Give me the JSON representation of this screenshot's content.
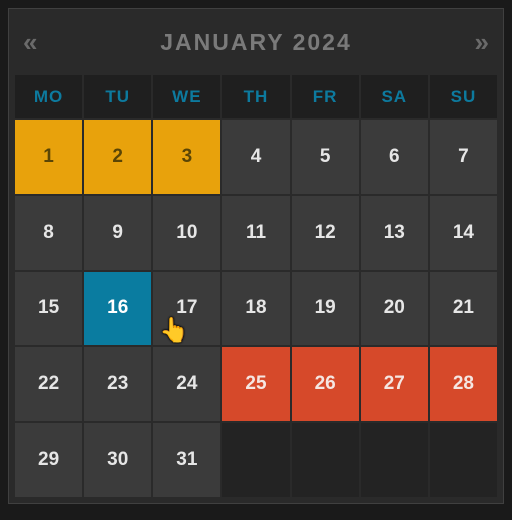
{
  "header": {
    "title": "JANUARY 2024",
    "prev_icon": "«",
    "next_icon": "»"
  },
  "dow": [
    "MO",
    "TU",
    "WE",
    "TH",
    "FR",
    "SA",
    "SU"
  ],
  "cells": [
    {
      "n": "1",
      "s": "yellow"
    },
    {
      "n": "2",
      "s": "yellow"
    },
    {
      "n": "3",
      "s": "yellow"
    },
    {
      "n": "4",
      "s": ""
    },
    {
      "n": "5",
      "s": ""
    },
    {
      "n": "6",
      "s": ""
    },
    {
      "n": "7",
      "s": ""
    },
    {
      "n": "8",
      "s": ""
    },
    {
      "n": "9",
      "s": ""
    },
    {
      "n": "10",
      "s": ""
    },
    {
      "n": "11",
      "s": ""
    },
    {
      "n": "12",
      "s": ""
    },
    {
      "n": "13",
      "s": ""
    },
    {
      "n": "14",
      "s": ""
    },
    {
      "n": "15",
      "s": ""
    },
    {
      "n": "16",
      "s": "selected"
    },
    {
      "n": "17",
      "s": ""
    },
    {
      "n": "18",
      "s": ""
    },
    {
      "n": "19",
      "s": ""
    },
    {
      "n": "20",
      "s": ""
    },
    {
      "n": "21",
      "s": ""
    },
    {
      "n": "22",
      "s": ""
    },
    {
      "n": "23",
      "s": ""
    },
    {
      "n": "24",
      "s": ""
    },
    {
      "n": "25",
      "s": "red"
    },
    {
      "n": "26",
      "s": "red"
    },
    {
      "n": "27",
      "s": "red"
    },
    {
      "n": "28",
      "s": "red"
    },
    {
      "n": "29",
      "s": ""
    },
    {
      "n": "30",
      "s": ""
    },
    {
      "n": "31",
      "s": ""
    },
    {
      "n": "",
      "s": "empty"
    },
    {
      "n": "",
      "s": "empty"
    },
    {
      "n": "",
      "s": "empty"
    },
    {
      "n": "",
      "s": "empty"
    }
  ],
  "cursor_glyph": "👆"
}
